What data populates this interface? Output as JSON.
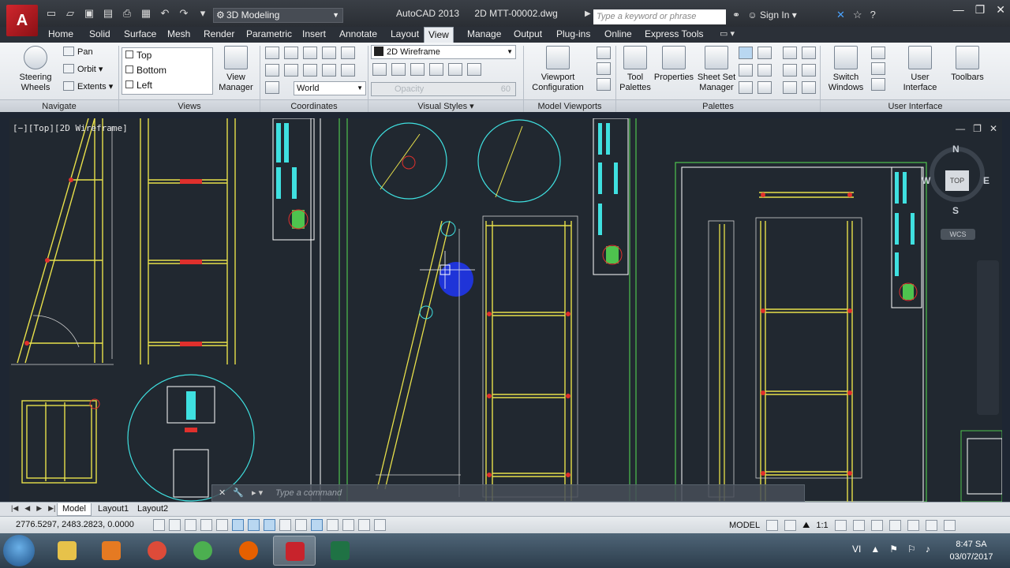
{
  "window": {
    "app_name": "AutoCAD 2013",
    "file_name": "2D MTT-00002.dwg",
    "workspace": "3D Modeling",
    "search_placeholder": "Type a keyword or phrase",
    "sign_in": "Sign In"
  },
  "ribbon_tabs": [
    "Home",
    "Solid",
    "Surface",
    "Mesh",
    "Render",
    "Parametric",
    "Insert",
    "Annotate",
    "Layout",
    "View",
    "Manage",
    "Output",
    "Plug-ins",
    "Online",
    "Express Tools"
  ],
  "active_tab": "View",
  "ribbon": {
    "navigate": {
      "label": "Navigate",
      "steering_wheels": "Steering\nWheels",
      "pan": "Pan",
      "orbit": "Orbit",
      "extents": "Extents"
    },
    "views": {
      "label": "Views",
      "items": [
        "Top",
        "Bottom",
        "Left"
      ],
      "view_manager": "View\nManager"
    },
    "coordinates": {
      "label": "Coordinates",
      "ucs": "World"
    },
    "visual_styles": {
      "label": "Visual Styles",
      "style": "2D Wireframe",
      "opacity_label": "Opacity",
      "opacity_value": "60"
    },
    "model_viewports": {
      "label": "Model Viewports",
      "viewport_configuration": "Viewport\nConfiguration"
    },
    "palettes": {
      "label": "Palettes",
      "tool_palettes": "Tool\nPalettes",
      "properties": "Properties",
      "sheet_set_manager": "Sheet Set\nManager"
    },
    "user_interface": {
      "label": "User Interface",
      "switch_windows": "Switch\nWindows",
      "user_interface": "User\nInterface",
      "toolbars": "Toolbars"
    }
  },
  "viewport": {
    "label": "[−][Top][2D Wireframe]",
    "viewcube": {
      "top": "TOP",
      "n": "N",
      "s": "S",
      "e": "E",
      "w": "W",
      "wcs": "WCS"
    }
  },
  "command_line": {
    "placeholder": "Type a command"
  },
  "layout_tabs": [
    "Model",
    "Layout1",
    "Layout2"
  ],
  "active_layout": "Model",
  "status_bar": {
    "coordinates": "2776.5297, 2483.2823, 0.0000",
    "space": "MODEL",
    "annotation_scale": "1:1"
  },
  "taskbar": {
    "language": "VI",
    "time": "8:47 SA",
    "date": "03/07/2017"
  },
  "colors": {
    "canvas_bg": "#212830",
    "ribbon_bg": "#e6e9ed",
    "title_bg": "#2f343a",
    "accent_green": "#4ec34e",
    "accent_cyan": "#3fe0e0",
    "accent_yellow": "#e8e04a",
    "accent_red": "#e0302c"
  }
}
